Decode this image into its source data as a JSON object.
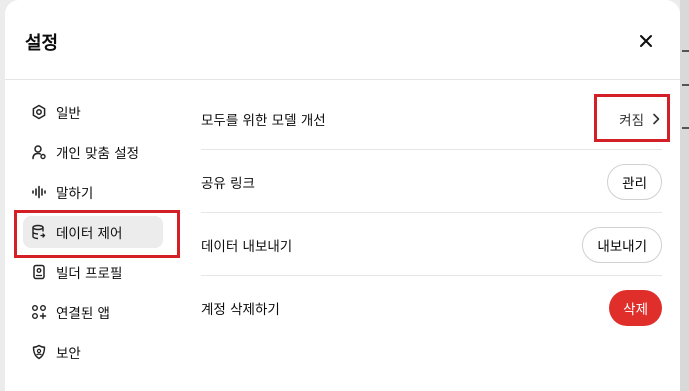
{
  "dialog": {
    "title": "설정",
    "close_icon": "close-icon"
  },
  "sidebar": {
    "items": [
      {
        "label": "일반",
        "icon": "gear-icon"
      },
      {
        "label": "개인 맞춤 설정",
        "icon": "personalization-icon"
      },
      {
        "label": "말하기",
        "icon": "waveform-icon"
      },
      {
        "label": "데이터 제어",
        "icon": "database-icon",
        "active": true
      },
      {
        "label": "빌더 프로필",
        "icon": "id-card-icon"
      },
      {
        "label": "연결된 앱",
        "icon": "apps-grid-icon"
      },
      {
        "label": "보안",
        "icon": "shield-icon"
      }
    ]
  },
  "content": {
    "rows": [
      {
        "label": "모두를 위한 모델 개선",
        "control": "켜짐",
        "control_type": "link",
        "icon": "chevron-right-icon"
      },
      {
        "label": "공유 링크",
        "control": "관리",
        "control_type": "button"
      },
      {
        "label": "데이터 내보내기",
        "control": "내보내기",
        "control_type": "button"
      },
      {
        "label": "계정 삭제하기",
        "control": "삭제",
        "control_type": "danger-button"
      }
    ]
  },
  "colors": {
    "danger": "#e02e2a",
    "highlight": "#d31f26",
    "active_bg": "#ececec"
  }
}
